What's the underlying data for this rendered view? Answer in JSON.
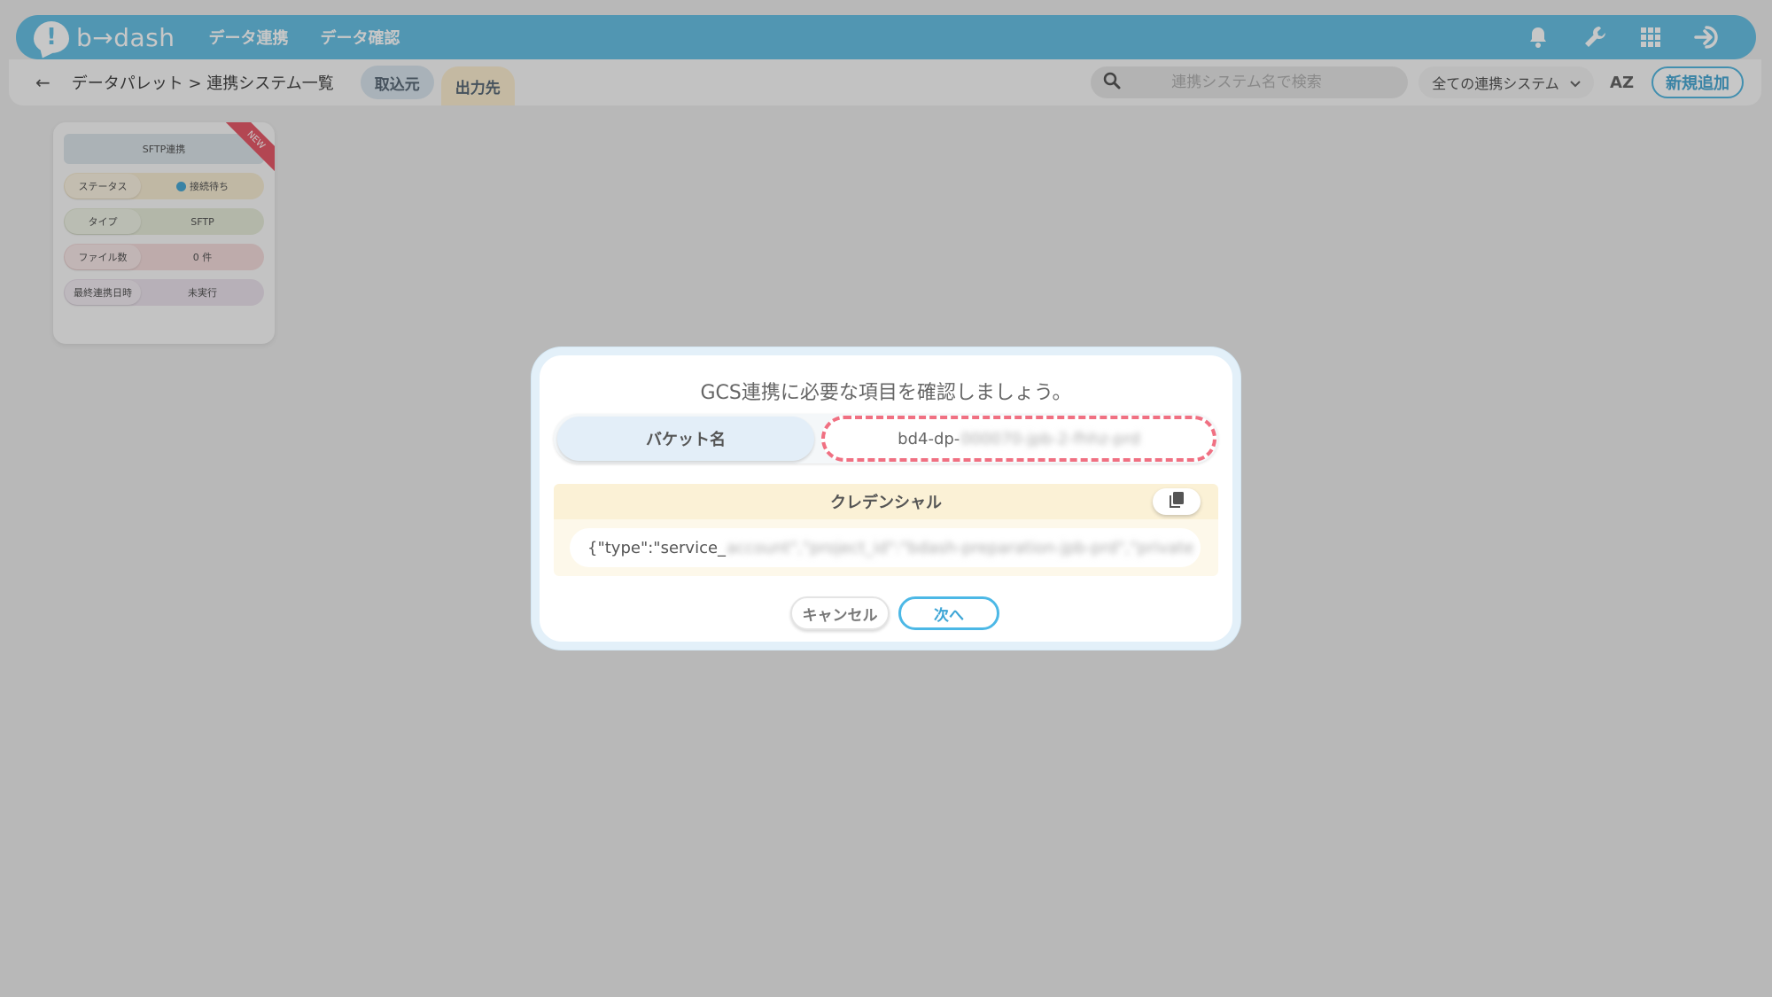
{
  "app": {
    "logo_text": "b→dash",
    "nav": [
      "データ連携",
      "データ確認"
    ],
    "icons": [
      "bell-icon",
      "wrench-icon",
      "grid-icon",
      "logout-icon"
    ],
    "accent_color": "#68c0e4"
  },
  "subheader": {
    "back_icon": "←",
    "breadcrumb": "データパレット > 連携システム一覧",
    "tabs": [
      "取込元",
      "出力先"
    ],
    "search_placeholder": "連携システム名で検索",
    "filter_selected": "全ての連携システム",
    "sort_label": "AZ",
    "add_button": "新規追加"
  },
  "card": {
    "title": "SFTP連携",
    "badge": "NEW",
    "rows": [
      {
        "label": "ステータス",
        "value": "接続待ち"
      },
      {
        "label": "タイプ",
        "value": "SFTP"
      },
      {
        "label": "ファイル数",
        "value": "0 件"
      },
      {
        "label": "最終連携日時",
        "value": "未実行"
      }
    ]
  },
  "modal": {
    "title": "GCS連携に必要な項目を確認しましょう。",
    "bucket_label": "バケット名",
    "bucket_value_visible": "bd4-dp-",
    "bucket_value_masked": "000070-jpb-2-fhhz-prd",
    "credential_label": "クレデンシャル",
    "credential_value_visible": "{\"type\":\"service_",
    "credential_value_masked": "account\",\"project_id\":\"bdash-preparation-jpb-prd\",\"private",
    "cancel_button": "キャンセル",
    "next_button": "次へ",
    "highlight_color": "#f07082"
  }
}
